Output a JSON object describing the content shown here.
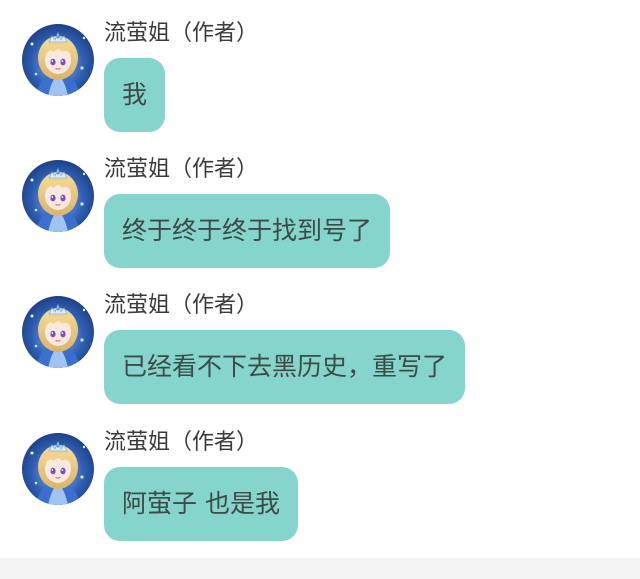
{
  "colors": {
    "bubble": "#85d5cc",
    "bubble_text": "#3c4a48",
    "sender_text": "#3a3a3a",
    "background": "#ffffff"
  },
  "avatar_icon": "anime-girl-avatar-icon",
  "messages": [
    {
      "sender": "流萤姐（作者）",
      "text": "我"
    },
    {
      "sender": "流萤姐（作者）",
      "text": "终于终于终于找到号了"
    },
    {
      "sender": "流萤姐（作者）",
      "text": "已经看不下去黑历史，重写了"
    },
    {
      "sender": "流萤姐（作者）",
      "text": "阿萤子 也是我"
    }
  ]
}
